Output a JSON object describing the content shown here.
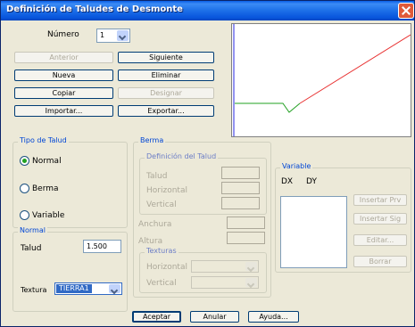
{
  "window": {
    "title": "Definición de Taludes de Desmonte"
  },
  "numero": {
    "label": "Número",
    "value": "1"
  },
  "buttons": {
    "anterior": "Anterior",
    "siguiente": "Siguiente",
    "nueva": "Nueva",
    "eliminar": "Eliminar",
    "copiar": "Copiar",
    "designar": "Designar",
    "importar": "Importar...",
    "exportar": "Exportar..."
  },
  "tipo_talud": {
    "title": "Tipo de Talud",
    "options": [
      "Normal",
      "Berma",
      "Variable"
    ],
    "selected": "Normal"
  },
  "normal": {
    "title": "Normal",
    "talud_label": "Talud",
    "talud_value": "1.500",
    "textura_label": "Textura",
    "textura_value": "TIERRA1"
  },
  "berma": {
    "title": "Berma",
    "definicion_title": "Definición del Talud",
    "talud_label": "Talud",
    "horizontal_label": "Horizontal",
    "vertical_label": "Vertical",
    "anchura_label": "Anchura",
    "altura_label": "Altura",
    "texturas_title": "Texturas",
    "tex_horizontal_label": "Horizontal",
    "tex_vertical_label": "Vertical"
  },
  "variable": {
    "title": "Variable",
    "col_dx": "DX",
    "col_dy": "DY",
    "insertar_prv": "Insertar Prv",
    "insertar_sig": "Insertar Sig",
    "editar": "Editar...",
    "borrar": "Borrar"
  },
  "footer": {
    "aceptar": "Aceptar",
    "anular": "Anular",
    "ayuda": "Ayuda..."
  },
  "colors": {
    "titlebar": "#0a5ee6",
    "profile_ground": "#22a022",
    "profile_slope": "#e83030",
    "axis": "#2a2ae0"
  }
}
